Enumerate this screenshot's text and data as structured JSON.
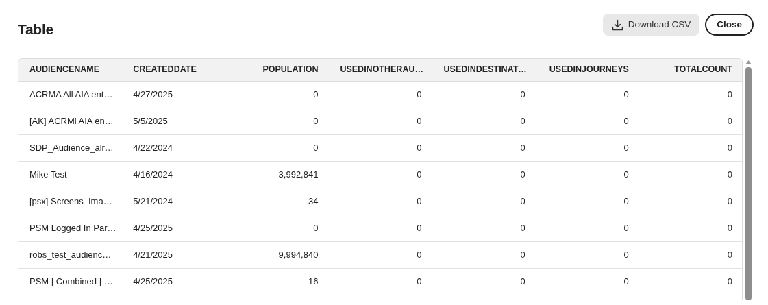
{
  "dialog": {
    "title": "Table"
  },
  "buttons": [
    {
      "kind": "download",
      "label": "Download CSV"
    },
    {
      "kind": "close",
      "label": "Close"
    }
  ],
  "table": {
    "columns": [
      {
        "label": "AUDIENCENAME",
        "kind": "text"
      },
      {
        "label": "CREATEDDATE",
        "kind": "text"
      },
      {
        "label": "POPULATION",
        "kind": "number"
      },
      {
        "label": "USEDINOTHERAU…",
        "kind": "number"
      },
      {
        "label": "USEDINDESTINAT…",
        "kind": "number"
      },
      {
        "label": "USEDINJOURNEYS",
        "kind": "number"
      },
      {
        "label": "TOTALCOUNT",
        "kind": "number"
      }
    ],
    "rows": [
      [
        "ACRMA All AIA ent…",
        "4/27/2025",
        "0",
        "0",
        "0",
        "0",
        "0"
      ],
      [
        "[AK] ACRMi AIA en…",
        "5/5/2025",
        "0",
        "0",
        "0",
        "0",
        "0"
      ],
      [
        "SDP_Audience_alr…",
        "4/22/2024",
        "0",
        "0",
        "0",
        "0",
        "0"
      ],
      [
        "Mike Test",
        "4/16/2024",
        "3,992,841",
        "0",
        "0",
        "0",
        "0"
      ],
      [
        "[psx] Screens_Ima…",
        "5/21/2024",
        "34",
        "0",
        "0",
        "0",
        "0"
      ],
      [
        "PSM Logged In Par…",
        "4/25/2025",
        "0",
        "0",
        "0",
        "0",
        "0"
      ],
      [
        "robs_test_audienc…",
        "4/21/2025",
        "9,994,840",
        "0",
        "0",
        "0",
        "0"
      ],
      [
        "PSM | Combined | …",
        "4/25/2025",
        "16",
        "0",
        "0",
        "0",
        "0"
      ]
    ]
  }
}
